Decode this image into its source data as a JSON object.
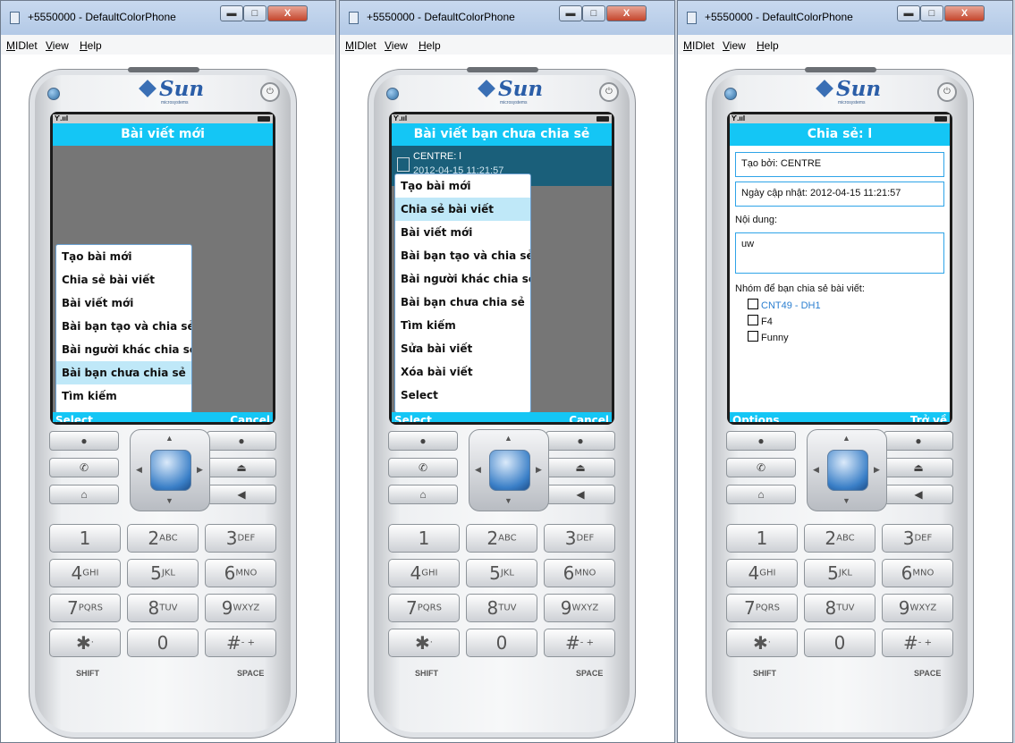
{
  "window": {
    "title": "+5550000 - DefaultColorPhone",
    "menu": [
      "MIDlet",
      "View",
      "Help"
    ],
    "btn_min": "▬",
    "btn_max": "□",
    "btn_close": "X"
  },
  "phone": {
    "brand": "Sun",
    "brand_sub": "microsystems",
    "signal": "Ƴ.ııl",
    "power": "⏻"
  },
  "screen1": {
    "header": "Bài viết mới",
    "menu": [
      "Tạo bài mới",
      "Chia sẻ bài viết",
      "Bài viết mới",
      "Bài bạn tạo và chia sẻ",
      "Bài người khác chia sẻ",
      "Bài bạn chưa chia sẻ",
      "Tìm kiếm"
    ],
    "highlighted": "Bài bạn chưa chia sẻ",
    "left_soft": "Select",
    "right_soft": "Cancel"
  },
  "screen2": {
    "header": "Bài viết bạn chưa chia sẻ",
    "selected_item": "CENTRE: l",
    "selected_item_sub": "2012-04-15 11:21:57",
    "menu": [
      "Tạo bài mới",
      "Chia sẻ bài viết",
      "Bài viết mới",
      "Bài bạn tạo và chia sẻ",
      "Bài người khác chia sẻ",
      "Bài bạn chưa chia sẻ",
      "Tìm kiếm",
      "Sửa bài viết",
      "Xóa bài viết",
      "Select"
    ],
    "highlighted": "Chia sẻ bài viết",
    "left_soft": "Select",
    "right_soft": "Cancel"
  },
  "screen3": {
    "header": "Chia sẻ: l",
    "created_by": "Tạo bởi: CENTRE",
    "updated": "Ngày cập nhật: 2012-04-15 11:21:57",
    "content_label": "Nội dung:",
    "content_value": "uw",
    "groups_label": "Nhóm để bạn chia sẻ bài viết:",
    "groups": [
      "CNT49 - DH1",
      "F4",
      "Funny"
    ],
    "left_soft": "Options",
    "right_soft": "Trở về"
  },
  "keys": {
    "row1": [
      {
        "n": "1",
        "l": ""
      },
      {
        "n": "2",
        "l": "ABC"
      },
      {
        "n": "3",
        "l": "DEF"
      }
    ],
    "row2": [
      {
        "n": "4",
        "l": "GHI"
      },
      {
        "n": "5",
        "l": "JKL"
      },
      {
        "n": "6",
        "l": "MNO"
      }
    ],
    "row3": [
      {
        "n": "7",
        "l": "PQRS"
      },
      {
        "n": "8",
        "l": "TUV"
      },
      {
        "n": "9",
        "l": "WXYZ"
      }
    ],
    "row4": [
      {
        "n": "✱",
        "l": "·"
      },
      {
        "n": "0",
        "l": ""
      },
      {
        "n": "#",
        "l": "- +"
      }
    ],
    "shift": "SHIFT",
    "space": "SPACE"
  },
  "colors": {
    "accent": "#14c6f5",
    "selection": "#bfe8f8",
    "list_selected": "#1a5f7a"
  }
}
